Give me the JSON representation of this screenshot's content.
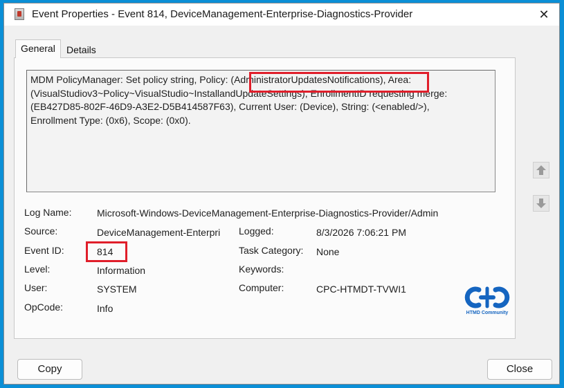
{
  "window": {
    "title": "Event Properties - Event 814, DeviceManagement-Enterprise-Diagnostics-Provider",
    "close_glyph": "✕"
  },
  "tabs": [
    {
      "label": "General",
      "selected": true
    },
    {
      "label": "Details",
      "selected": false
    }
  ],
  "description": {
    "line1": "MDM PolicyManager: Set policy string, Policy: (AdministratorUpdatesNotifications), Area:",
    "line2": "(VisualStudiov3~Policy~VisualStudio~InstallandUpdateSettings), EnrollmentID requesting merge:",
    "line3": "(EB427D85-802F-46D9-A3E2-D5B414587F63), Current User: (Device), String: (<enabled/>),",
    "line4": "Enrollment Type: (0x6), Scope: (0x0)."
  },
  "fields": {
    "log_name": {
      "label": "Log Name:",
      "value": "Microsoft-Windows-DeviceManagement-Enterprise-Diagnostics-Provider/Admin"
    },
    "source": {
      "label": "Source:",
      "value": "DeviceManagement-Enterpri"
    },
    "logged": {
      "label": "Logged:",
      "value": "8/3/2026 7:06:21 PM"
    },
    "event_id": {
      "label": "Event ID:",
      "value": "814"
    },
    "task_category": {
      "label": "Task Category:",
      "value": "None"
    },
    "level": {
      "label": "Level:",
      "value": "Information"
    },
    "keywords": {
      "label": "Keywords:",
      "value": ""
    },
    "user": {
      "label": "User:",
      "value": "SYSTEM"
    },
    "computer": {
      "label": "Computer:",
      "value": "CPC-HTMDT-TVWI1"
    },
    "opcode": {
      "label": "OpCode:",
      "value": "Info"
    }
  },
  "logo": {
    "caption": "HTMD Community"
  },
  "buttons": {
    "copy": "Copy",
    "close": "Close"
  },
  "colors": {
    "highlight": "#e01e2a",
    "background": "#0b8fd6",
    "logo_blue": "#1565c0"
  },
  "icons": [
    "app-event-icon",
    "close-icon",
    "arrow-up-icon",
    "arrow-down-icon",
    "htmd-logo-icon"
  ]
}
